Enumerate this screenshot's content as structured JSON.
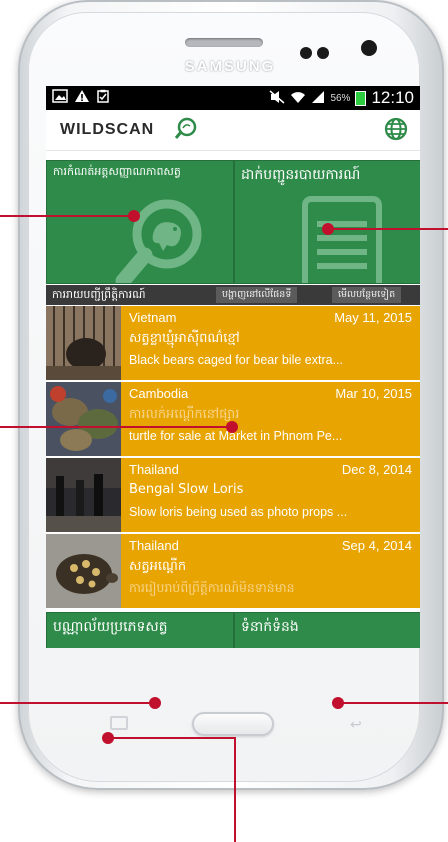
{
  "device": {
    "brand": "SAMSUNG"
  },
  "status_bar": {
    "left_icons": [
      "image-icon",
      "warning-icon",
      "clipboard-icon"
    ],
    "battery_percent": "56%",
    "time": "12:10"
  },
  "app": {
    "logo": "WILDSCAN",
    "menu_icon": "globe-icon"
  },
  "tiles": {
    "identify": {
      "label": "ការកំណត់អត្តសញ្ញាណភាពសត្វ"
    },
    "report": {
      "label": "ដាក់បញ្ជូនរបាយការណ៍"
    },
    "library": {
      "label": "បណ្ណាល័យប្រភេទសត្វ"
    },
    "contacts": {
      "label": "ទំនាក់ទំនង"
    }
  },
  "news_header": {
    "title": "ការរាយបញ្ជីព្រឹត្តិការណ៍",
    "map_tab": "បង្ហាញនៅលើផែនទី",
    "more_tab": "មើលបន្ថែមទៀត"
  },
  "news": [
    {
      "country": "Vietnam",
      "date": "May 11, 2015",
      "title": "សត្វខ្លាឃ្មុំអាស៊ីពណ៌ខ្មៅ",
      "desc": "Black bears caged for bear bile extra..."
    },
    {
      "country": "Cambodia",
      "date": "Mar 10, 2015",
      "title": "ការលក់អណ្តើកនៅផ្សារ",
      "desc": "turtle for sale at Market in Phnom Pe..."
    },
    {
      "country": "Thailand",
      "date": "Dec 8, 2014",
      "title": "Bengal Slow Loris",
      "desc": "Slow loris being used as photo props ..."
    },
    {
      "country": "Thailand",
      "date": "Sep 4, 2014",
      "title": "សត្វអណ្តើក",
      "desc": "ការរៀបរាប់ពីព្រឹត្តិការណ៍មិនទាន់មាន"
    }
  ],
  "colors": {
    "tile_green": "#2e8b4a",
    "news_orange": "#e8a400",
    "callout_red": "#c0102e"
  }
}
